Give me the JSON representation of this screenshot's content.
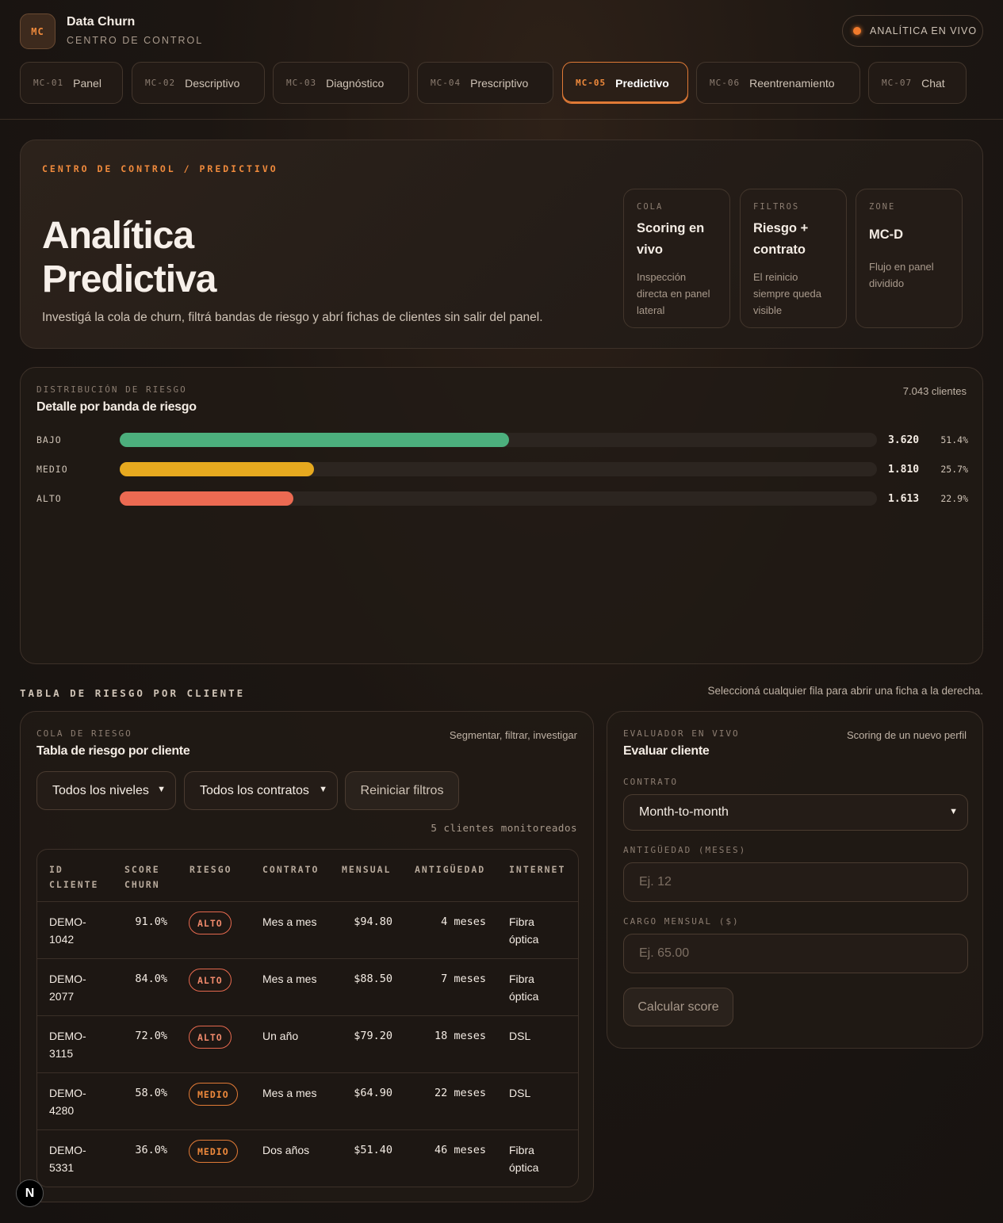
{
  "header": {
    "logo": "MC",
    "brand_title": "Data Churn",
    "brand_sub": "CENTRO DE CONTROL",
    "live_label": "ANALÍTICA EN VIVO",
    "tabs": [
      {
        "code": "MC-01",
        "label": "Panel"
      },
      {
        "code": "MC-02",
        "label": "Descriptivo"
      },
      {
        "code": "MC-03",
        "label": "Diagnóstico"
      },
      {
        "code": "MC-04",
        "label": "Prescriptivo"
      },
      {
        "code": "MC-05",
        "label": "Predictivo"
      },
      {
        "code": "MC-06",
        "label": "Reentrenamiento"
      },
      {
        "code": "MC-07",
        "label": "Chat"
      }
    ],
    "active_tab": "MC-05"
  },
  "hero": {
    "breadcrumb": "CENTRO DE CONTROL / PREDICTIVO",
    "title": "Analítica Predictiva",
    "description": "Investigá la cola de churn, filtrá bandas de riesgo y abrí fichas de clientes sin salir del panel.",
    "cards": [
      {
        "label": "COLA",
        "value": "Scoring en vivo",
        "text": "Inspección directa en panel lateral"
      },
      {
        "label": "FILTROS",
        "value": "Riesgo + contrato",
        "text": "El reinicio siempre queda visible"
      },
      {
        "label": "ZONE",
        "value": "MC-D",
        "text": "Flujo en panel dividido"
      }
    ]
  },
  "distribution": {
    "label": "DISTRIBUCIÓN DE RIESGO",
    "title": "Detalle por banda de riesgo",
    "total": "7.043 clientes",
    "bands": [
      {
        "name": "BAJO",
        "count": "3.620",
        "pct": "51.4%",
        "fraction": 0.514,
        "color": "#4caf7d"
      },
      {
        "name": "MEDIO",
        "count": "1.810",
        "pct": "25.7%",
        "fraction": 0.257,
        "color": "#e6a91f"
      },
      {
        "name": "ALTO",
        "count": "1.613",
        "pct": "22.9%",
        "fraction": 0.229,
        "color": "#ec6a52"
      }
    ]
  },
  "table_section": {
    "heading": "TABLA DE RIESGO POR CLIENTE",
    "hint": "Seleccioná cualquier fila para abrir una ficha a la derecha."
  },
  "queue": {
    "label": "COLA DE RIESGO",
    "title": "Tabla de riesgo por cliente",
    "subtitle": "Segmentar, filtrar, investigar",
    "filter_level": "Todos los niveles",
    "filter_contract": "Todos los contratos",
    "reset_label": "Reiniciar filtros",
    "count_label": "5 clientes monitoreados",
    "columns": [
      "ID CLIENTE",
      "SCORE CHURN",
      "RIESGO",
      "CONTRATO",
      "MENSUAL",
      "ANTIGÜEDAD",
      "INTERNET"
    ],
    "rows": [
      {
        "id": "DEMO-1042",
        "score": "91.0%",
        "risk": "ALTO",
        "contract": "Mes a mes",
        "monthly": "$94.80",
        "tenure": "4 meses",
        "internet": "Fibra óptica"
      },
      {
        "id": "DEMO-2077",
        "score": "84.0%",
        "risk": "ALTO",
        "contract": "Mes a mes",
        "monthly": "$88.50",
        "tenure": "7 meses",
        "internet": "Fibra óptica"
      },
      {
        "id": "DEMO-3115",
        "score": "72.0%",
        "risk": "ALTO",
        "contract": "Un año",
        "monthly": "$79.20",
        "tenure": "18 meses",
        "internet": "DSL"
      },
      {
        "id": "DEMO-4280",
        "score": "58.0%",
        "risk": "MEDIO",
        "contract": "Mes a mes",
        "monthly": "$64.90",
        "tenure": "22 meses",
        "internet": "DSL"
      },
      {
        "id": "DEMO-5331",
        "score": "36.0%",
        "risk": "MEDIO",
        "contract": "Dos años",
        "monthly": "$51.40",
        "tenure": "46 meses",
        "internet": "Fibra óptica"
      }
    ]
  },
  "evaluator": {
    "label": "EVALUADOR EN VIVO",
    "title": "Evaluar cliente",
    "subtitle": "Scoring de un nuevo perfil",
    "contract_label": "CONTRATO",
    "contract_value": "Month-to-month",
    "tenure_label": "ANTIGÜEDAD (MESES)",
    "tenure_placeholder": "Ej. 12",
    "charge_label": "CARGO MENSUAL ($)",
    "charge_placeholder": "Ej. 65.00",
    "submit_label": "Calcular score"
  },
  "dev_badge": "N"
}
